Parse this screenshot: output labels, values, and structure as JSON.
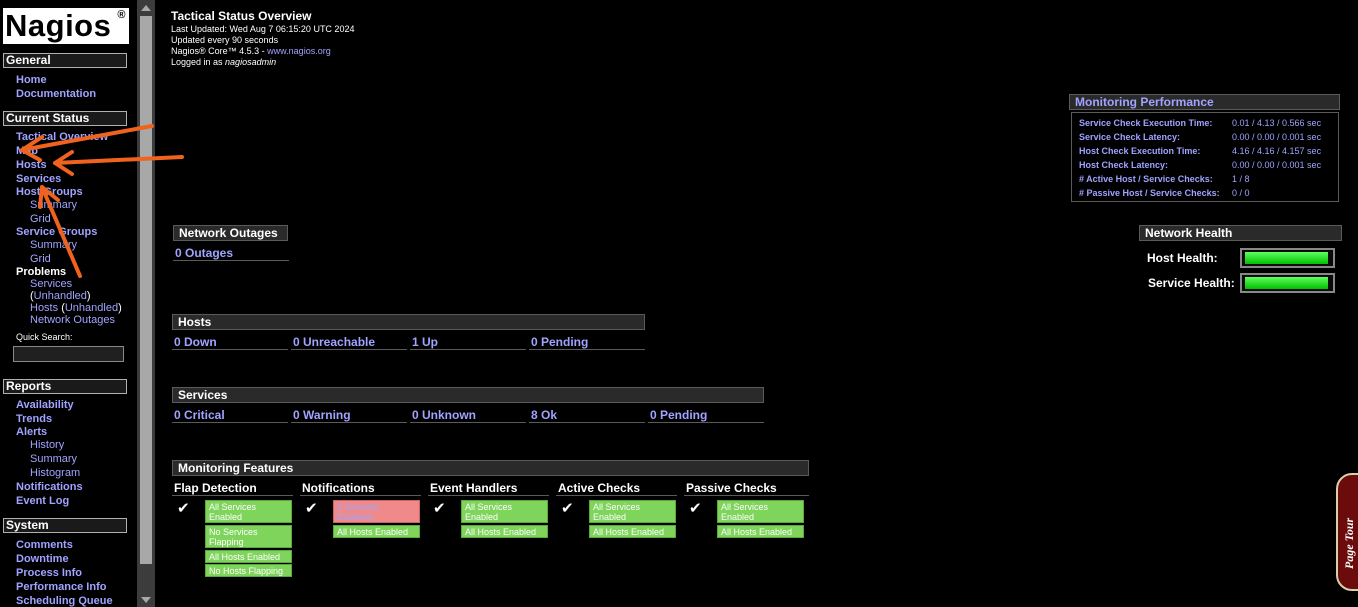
{
  "sidebar": {
    "logo_text": "Nagios",
    "logo_reg": "®",
    "sections": {
      "general": "General",
      "current_status": "Current Status",
      "reports": "Reports",
      "system": "System"
    },
    "general_items": [
      "Home",
      "Documentation"
    ],
    "current_status": {
      "tactical_overview": "Tactical Overview",
      "map": "Map",
      "hosts": "Hosts",
      "services": "Services",
      "host_groups": "Host Groups",
      "hg_summary": "Summary",
      "hg_grid": "Grid",
      "service_groups": "Service Groups",
      "sg_summary": "Summary",
      "sg_grid": "Grid",
      "problems": "Problems",
      "p_services": "Services",
      "p_unhandled_open": "(",
      "p_unhandled": "Unhandled",
      "p_unhandled_close": ")",
      "p_hosts": "Hosts",
      "p_hosts_unhandled": "Unhandled",
      "p_network_outages": "Network Outages",
      "quick_search_label": "Quick Search:"
    },
    "reports": {
      "availability": "Availability",
      "trends": "Trends",
      "alerts": "Alerts",
      "history": "History",
      "summary": "Summary",
      "histogram": "Histogram",
      "notifications": "Notifications",
      "event_log": "Event Log"
    },
    "system": {
      "comments": "Comments",
      "downtime": "Downtime",
      "process_info": "Process Info",
      "performance_info": "Performance Info",
      "scheduling_queue": "Scheduling Queue"
    }
  },
  "header": {
    "title": "Tactical Status Overview",
    "last_updated": "Last Updated: Wed Aug 7 06:15:20 UTC 2024",
    "update_interval": "Updated every 90 seconds",
    "version_prefix": "Nagios® Core™ 4.5.3 - ",
    "version_link": "www.nagios.org",
    "logged_in_prefix": "Logged in as ",
    "logged_in_user": "nagiosadmin"
  },
  "monitoring_performance": {
    "title": "Monitoring Performance",
    "rows": [
      {
        "label": "Service Check Execution Time:",
        "value": "0.01 / 4.13 / 0.566 sec"
      },
      {
        "label": "Service Check Latency:",
        "value": "0.00 / 0.00 / 0.001 sec"
      },
      {
        "label": "Host Check Execution Time:",
        "value": "4.16 / 4.16 / 4.157 sec"
      },
      {
        "label": "Host Check Latency:",
        "value": "0.00 / 0.00 / 0.001 sec"
      },
      {
        "label": "# Active Host / Service Checks:",
        "value": "1 / 8"
      },
      {
        "label": "# Passive Host / Service Checks:",
        "value": "0 / 0"
      }
    ]
  },
  "network_outages": {
    "title": "Network Outages",
    "value": "0 Outages"
  },
  "network_health": {
    "title": "Network Health",
    "host_label": "Host Health:",
    "service_label": "Service Health:",
    "host_health_percent": 100,
    "service_health_percent": 100
  },
  "hosts": {
    "title": "Hosts",
    "cells": [
      "0 Down",
      "0 Unreachable",
      "1 Up",
      "0 Pending"
    ]
  },
  "services": {
    "title": "Services",
    "cells": [
      "0 Critical",
      "0 Warning",
      "0 Unknown",
      "8 Ok",
      "0 Pending"
    ]
  },
  "monitoring_features": {
    "title": "Monitoring Features",
    "columns": [
      {
        "name": "Flap Detection",
        "badges": [
          "All Services Enabled",
          "No Services Flapping",
          "All Hosts Enabled",
          "No Hosts Flapping"
        ]
      },
      {
        "name": "Notifications",
        "badges": [
          "2 Services Disabled",
          "All Hosts Enabled"
        ]
      },
      {
        "name": "Event Handlers",
        "badges": [
          "All Services Enabled",
          "All Hosts Enabled"
        ]
      },
      {
        "name": "Active Checks",
        "badges": [
          "All Services Enabled",
          "All Hosts Enabled"
        ]
      },
      {
        "name": "Passive Checks",
        "badges": [
          "All Services Enabled",
          "All Hosts Enabled"
        ]
      }
    ]
  },
  "page_tour": "Page Tour",
  "colors": {
    "link": "#a0a3ff",
    "ok_badge": "#7fd45c",
    "problem_badge": "#f08a8a",
    "annotation_arrow": "#f0631e",
    "health_bar": "#00e000"
  }
}
